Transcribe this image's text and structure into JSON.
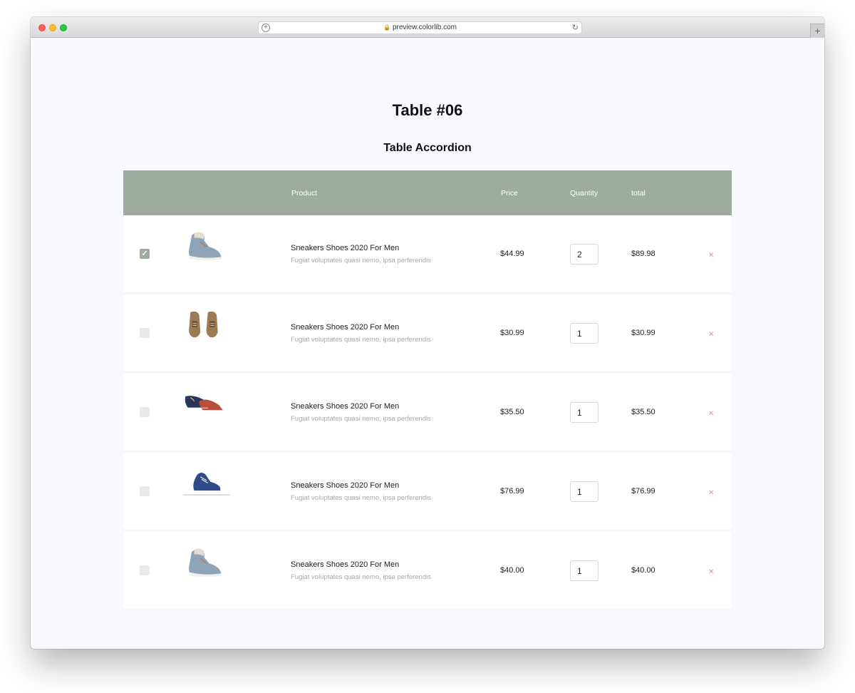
{
  "browser": {
    "url": "preview.colorlib.com",
    "icons": [
      "plus-circle-icon",
      "lock-icon",
      "reload-icon",
      "plus-icon"
    ]
  },
  "page": {
    "title": "Table #06",
    "subtitle": "Table Accordion"
  },
  "table": {
    "columns": [
      "",
      "",
      "Product",
      "Price",
      "Quantity",
      "total",
      ""
    ],
    "rows": [
      {
        "checked": true,
        "name": "Sneakers Shoes 2020 For Men",
        "description": "Fugiat voluptates quasi nemo, ipsa perferendis",
        "price": "$44.99",
        "quantity": "2",
        "total": "$89.98",
        "image": "high-top-sneaker-grey"
      },
      {
        "checked": false,
        "name": "Sneakers Shoes 2020 For Men",
        "description": "Fugiat voluptates quasi nemo, ipsa perferendis",
        "price": "$30.99",
        "quantity": "1",
        "total": "$30.99",
        "image": "brown-suede-shoes-pair"
      },
      {
        "checked": false,
        "name": "Sneakers Shoes 2020 For Men",
        "description": "Fugiat voluptates quasi nemo, ipsa perferendis",
        "price": "$35.50",
        "quantity": "1",
        "total": "$35.50",
        "image": "navy-and-red-loafers"
      },
      {
        "checked": false,
        "name": "Sneakers Shoes 2020 For Men",
        "description": "Fugiat voluptates quasi nemo, ipsa perferendis",
        "price": "$76.99",
        "quantity": "1",
        "total": "$76.99",
        "image": "blue-canvas-sneaker"
      },
      {
        "checked": false,
        "name": "Sneakers Shoes 2020 For Men",
        "description": "Fugiat voluptates quasi nemo, ipsa perferendis",
        "price": "$40.00",
        "quantity": "1",
        "total": "$40.00",
        "image": "high-top-sneaker-grey"
      }
    ],
    "remove_glyph": "×"
  },
  "colors": {
    "header_bg": "#9dac9f",
    "page_bg": "#f8f9fd",
    "remove_icon": "#e8a0a0"
  }
}
